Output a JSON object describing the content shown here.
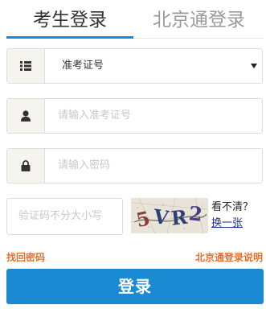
{
  "tabs": {
    "active_label": "考生登录",
    "inactive_label": "北京通登录"
  },
  "form": {
    "id_type": {
      "selected": "准考证号",
      "icon": "list-icon"
    },
    "exam_number": {
      "placeholder": "请输入准考证号",
      "value": "",
      "icon": "user-icon"
    },
    "password": {
      "placeholder": "请输入密码",
      "value": "",
      "icon": "lock-icon"
    },
    "captcha": {
      "placeholder": "验证码不分大小写",
      "image_text": "5VR2",
      "unclear_label": "看不清？",
      "refresh_label": "换一张"
    }
  },
  "links": {
    "recover_password": "找回密码",
    "beijingtong_help": "北京通登录说明"
  },
  "login_button": "登录",
  "colors": {
    "accent": "#1a8ad3",
    "link_orange": "#e8712a",
    "captcha_link": "#1f2fa8"
  }
}
